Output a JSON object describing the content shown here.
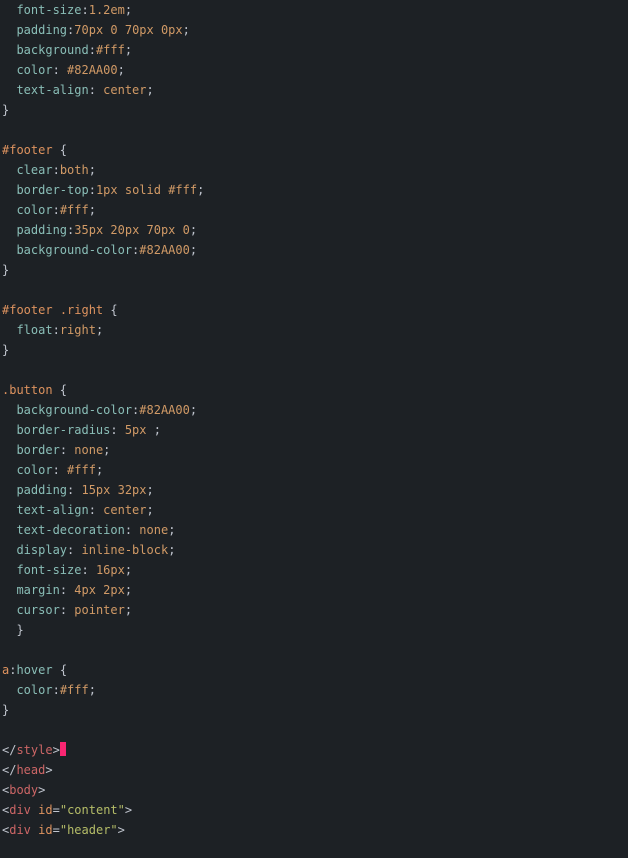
{
  "lines": [
    {
      "indent": 2,
      "tokens": [
        {
          "c": "prop",
          "t": "font-size"
        },
        {
          "c": "punct",
          "t": ":"
        },
        {
          "c": "num",
          "t": "1.2em"
        },
        {
          "c": "punct",
          "t": ";"
        }
      ]
    },
    {
      "indent": 2,
      "tokens": [
        {
          "c": "prop",
          "t": "padding"
        },
        {
          "c": "punct",
          "t": ":"
        },
        {
          "c": "num",
          "t": "70px 0 70px 0px"
        },
        {
          "c": "punct",
          "t": ";"
        }
      ]
    },
    {
      "indent": 2,
      "tokens": [
        {
          "c": "prop",
          "t": "background"
        },
        {
          "c": "punct",
          "t": ":"
        },
        {
          "c": "hex",
          "t": "#fff"
        },
        {
          "c": "punct",
          "t": ";"
        }
      ]
    },
    {
      "indent": 2,
      "tokens": [
        {
          "c": "prop",
          "t": "color"
        },
        {
          "c": "punct",
          "t": ": "
        },
        {
          "c": "hex",
          "t": "#82AA00"
        },
        {
          "c": "punct",
          "t": ";"
        }
      ]
    },
    {
      "indent": 2,
      "tokens": [
        {
          "c": "prop",
          "t": "text-align"
        },
        {
          "c": "punct",
          "t": ": "
        },
        {
          "c": "val",
          "t": "center"
        },
        {
          "c": "punct",
          "t": ";"
        }
      ]
    },
    {
      "indent": 0,
      "tokens": [
        {
          "c": "punct",
          "t": "}"
        }
      ]
    },
    {
      "indent": 0,
      "tokens": []
    },
    {
      "indent": 0,
      "tokens": [
        {
          "c": "sel",
          "t": "#footer"
        },
        {
          "c": "punct",
          "t": " {"
        }
      ]
    },
    {
      "indent": 2,
      "tokens": [
        {
          "c": "prop",
          "t": "clear"
        },
        {
          "c": "punct",
          "t": ":"
        },
        {
          "c": "val",
          "t": "both"
        },
        {
          "c": "punct",
          "t": ";"
        }
      ]
    },
    {
      "indent": 2,
      "tokens": [
        {
          "c": "prop",
          "t": "border-top"
        },
        {
          "c": "punct",
          "t": ":"
        },
        {
          "c": "num",
          "t": "1px "
        },
        {
          "c": "val",
          "t": "solid "
        },
        {
          "c": "hex",
          "t": "#fff"
        },
        {
          "c": "punct",
          "t": ";"
        }
      ]
    },
    {
      "indent": 2,
      "tokens": [
        {
          "c": "prop",
          "t": "color"
        },
        {
          "c": "punct",
          "t": ":"
        },
        {
          "c": "hex",
          "t": "#fff"
        },
        {
          "c": "punct",
          "t": ";"
        }
      ]
    },
    {
      "indent": 2,
      "tokens": [
        {
          "c": "prop",
          "t": "padding"
        },
        {
          "c": "punct",
          "t": ":"
        },
        {
          "c": "num",
          "t": "35px 20px 70px 0"
        },
        {
          "c": "punct",
          "t": ";"
        }
      ]
    },
    {
      "indent": 2,
      "tokens": [
        {
          "c": "prop",
          "t": "background-color"
        },
        {
          "c": "punct",
          "t": ":"
        },
        {
          "c": "hex",
          "t": "#82AA00"
        },
        {
          "c": "punct",
          "t": ";"
        }
      ]
    },
    {
      "indent": 0,
      "tokens": [
        {
          "c": "punct",
          "t": "}"
        }
      ]
    },
    {
      "indent": 0,
      "tokens": []
    },
    {
      "indent": 0,
      "tokens": [
        {
          "c": "sel",
          "t": "#footer"
        },
        {
          "c": "punct",
          "t": " "
        },
        {
          "c": "cls",
          "t": ".right"
        },
        {
          "c": "punct",
          "t": " {"
        }
      ]
    },
    {
      "indent": 2,
      "tokens": [
        {
          "c": "prop",
          "t": "float"
        },
        {
          "c": "punct",
          "t": ":"
        },
        {
          "c": "val",
          "t": "right"
        },
        {
          "c": "punct",
          "t": ";"
        }
      ]
    },
    {
      "indent": 0,
      "tokens": [
        {
          "c": "punct",
          "t": "}"
        }
      ]
    },
    {
      "indent": 0,
      "tokens": []
    },
    {
      "indent": 0,
      "tokens": [
        {
          "c": "cls",
          "t": ".button"
        },
        {
          "c": "punct",
          "t": " {"
        }
      ]
    },
    {
      "indent": 2,
      "tokens": [
        {
          "c": "prop",
          "t": "background-color"
        },
        {
          "c": "punct",
          "t": ":"
        },
        {
          "c": "hex",
          "t": "#82AA00"
        },
        {
          "c": "punct",
          "t": ";"
        }
      ]
    },
    {
      "indent": 2,
      "tokens": [
        {
          "c": "prop",
          "t": "border-radius"
        },
        {
          "c": "punct",
          "t": ": "
        },
        {
          "c": "num",
          "t": "5px "
        },
        {
          "c": "punct",
          "t": ";"
        }
      ]
    },
    {
      "indent": 2,
      "tokens": [
        {
          "c": "prop",
          "t": "border"
        },
        {
          "c": "punct",
          "t": ": "
        },
        {
          "c": "val",
          "t": "none"
        },
        {
          "c": "punct",
          "t": ";"
        }
      ]
    },
    {
      "indent": 2,
      "tokens": [
        {
          "c": "prop",
          "t": "color"
        },
        {
          "c": "punct",
          "t": ": "
        },
        {
          "c": "hex",
          "t": "#fff"
        },
        {
          "c": "punct",
          "t": ";"
        }
      ]
    },
    {
      "indent": 2,
      "tokens": [
        {
          "c": "prop",
          "t": "padding"
        },
        {
          "c": "punct",
          "t": ": "
        },
        {
          "c": "num",
          "t": "15px 32px"
        },
        {
          "c": "punct",
          "t": ";"
        }
      ]
    },
    {
      "indent": 2,
      "tokens": [
        {
          "c": "prop",
          "t": "text-align"
        },
        {
          "c": "punct",
          "t": ": "
        },
        {
          "c": "val",
          "t": "center"
        },
        {
          "c": "punct",
          "t": ";"
        }
      ]
    },
    {
      "indent": 2,
      "tokens": [
        {
          "c": "prop",
          "t": "text-decoration"
        },
        {
          "c": "punct",
          "t": ": "
        },
        {
          "c": "val",
          "t": "none"
        },
        {
          "c": "punct",
          "t": ";"
        }
      ]
    },
    {
      "indent": 2,
      "tokens": [
        {
          "c": "prop",
          "t": "display"
        },
        {
          "c": "punct",
          "t": ": "
        },
        {
          "c": "val",
          "t": "inline-block"
        },
        {
          "c": "punct",
          "t": ";"
        }
      ]
    },
    {
      "indent": 2,
      "tokens": [
        {
          "c": "prop",
          "t": "font-size"
        },
        {
          "c": "punct",
          "t": ": "
        },
        {
          "c": "num",
          "t": "16px"
        },
        {
          "c": "punct",
          "t": ";"
        }
      ]
    },
    {
      "indent": 2,
      "tokens": [
        {
          "c": "prop",
          "t": "margin"
        },
        {
          "c": "punct",
          "t": ": "
        },
        {
          "c": "num",
          "t": "4px 2px"
        },
        {
          "c": "punct",
          "t": ";"
        }
      ]
    },
    {
      "indent": 2,
      "tokens": [
        {
          "c": "prop",
          "t": "cursor"
        },
        {
          "c": "punct",
          "t": ": "
        },
        {
          "c": "val",
          "t": "pointer"
        },
        {
          "c": "punct",
          "t": ";"
        }
      ]
    },
    {
      "indent": 2,
      "tokens": [
        {
          "c": "punct",
          "t": "}"
        }
      ]
    },
    {
      "indent": 0,
      "tokens": []
    },
    {
      "indent": 0,
      "tokens": [
        {
          "c": "sel",
          "t": "a"
        },
        {
          "c": "punct",
          "t": ":"
        },
        {
          "c": "prop",
          "t": "hover"
        },
        {
          "c": "punct",
          "t": " {"
        }
      ]
    },
    {
      "indent": 2,
      "tokens": [
        {
          "c": "prop",
          "t": "color"
        },
        {
          "c": "punct",
          "t": ":"
        },
        {
          "c": "hex",
          "t": "#fff"
        },
        {
          "c": "punct",
          "t": ";"
        }
      ]
    },
    {
      "indent": 0,
      "tokens": [
        {
          "c": "punct",
          "t": "}"
        }
      ]
    },
    {
      "indent": 0,
      "tokens": []
    },
    {
      "indent": 0,
      "cursor": true,
      "tokens": [
        {
          "c": "bracket",
          "t": "</"
        },
        {
          "c": "tag",
          "t": "style"
        },
        {
          "c": "bracket",
          "t": ">"
        }
      ]
    },
    {
      "indent": 0,
      "tokens": [
        {
          "c": "bracket",
          "t": "</"
        },
        {
          "c": "tag",
          "t": "head"
        },
        {
          "c": "bracket",
          "t": ">"
        }
      ]
    },
    {
      "indent": 0,
      "tokens": [
        {
          "c": "bracket",
          "t": "<"
        },
        {
          "c": "tag",
          "t": "body"
        },
        {
          "c": "bracket",
          "t": ">"
        }
      ]
    },
    {
      "indent": 0,
      "tokens": [
        {
          "c": "bracket",
          "t": "<"
        },
        {
          "c": "tag",
          "t": "div"
        },
        {
          "c": "punct",
          "t": " "
        },
        {
          "c": "attr",
          "t": "id"
        },
        {
          "c": "punct",
          "t": "="
        },
        {
          "c": "str",
          "t": "\"content\""
        },
        {
          "c": "bracket",
          "t": ">"
        }
      ]
    },
    {
      "indent": 0,
      "tokens": [
        {
          "c": "bracket",
          "t": "<"
        },
        {
          "c": "tag",
          "t": "div"
        },
        {
          "c": "punct",
          "t": " "
        },
        {
          "c": "attr",
          "t": "id"
        },
        {
          "c": "punct",
          "t": "="
        },
        {
          "c": "str",
          "t": "\"header\""
        },
        {
          "c": "bracket",
          "t": ">"
        }
      ]
    }
  ]
}
